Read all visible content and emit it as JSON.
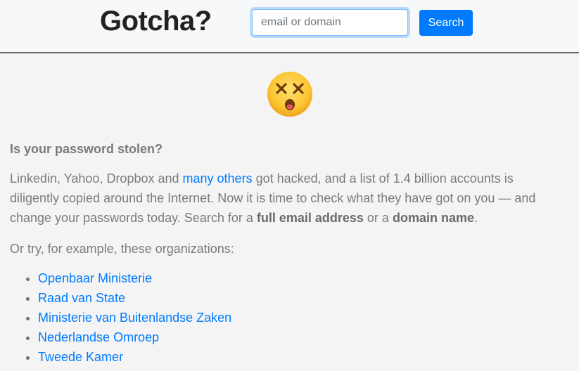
{
  "header": {
    "brand": "Gotcha?",
    "search_placeholder": "email or domain",
    "search_value": "",
    "search_button": "Search"
  },
  "hero": {
    "emoji_icon": "dizzy-face-emoji"
  },
  "main": {
    "question": "Is your password stolen?",
    "intro_before_link": "Linkedin, Yahoo, Dropbox and ",
    "intro_link": "many others",
    "intro_after_link": " got hacked, and a list of 1.4 billion accounts is diligently copied around the Internet. Now it is time to check what they have got on you — and change your passwords today. Search for a ",
    "intro_bold_1": "full email address",
    "intro_mid": " or a ",
    "intro_bold_2": "domain name",
    "intro_end": ".",
    "try_text": "Or try, for example, these organizations:",
    "organizations": [
      "Openbaar Ministerie",
      "Raad van State",
      "Ministerie van Buitenlandse Zaken",
      "Nederlandse Omroep",
      "Tweede Kamer"
    ]
  },
  "colors": {
    "accent": "#007bff",
    "text": "#7b7b7b",
    "brand": "#222222"
  }
}
